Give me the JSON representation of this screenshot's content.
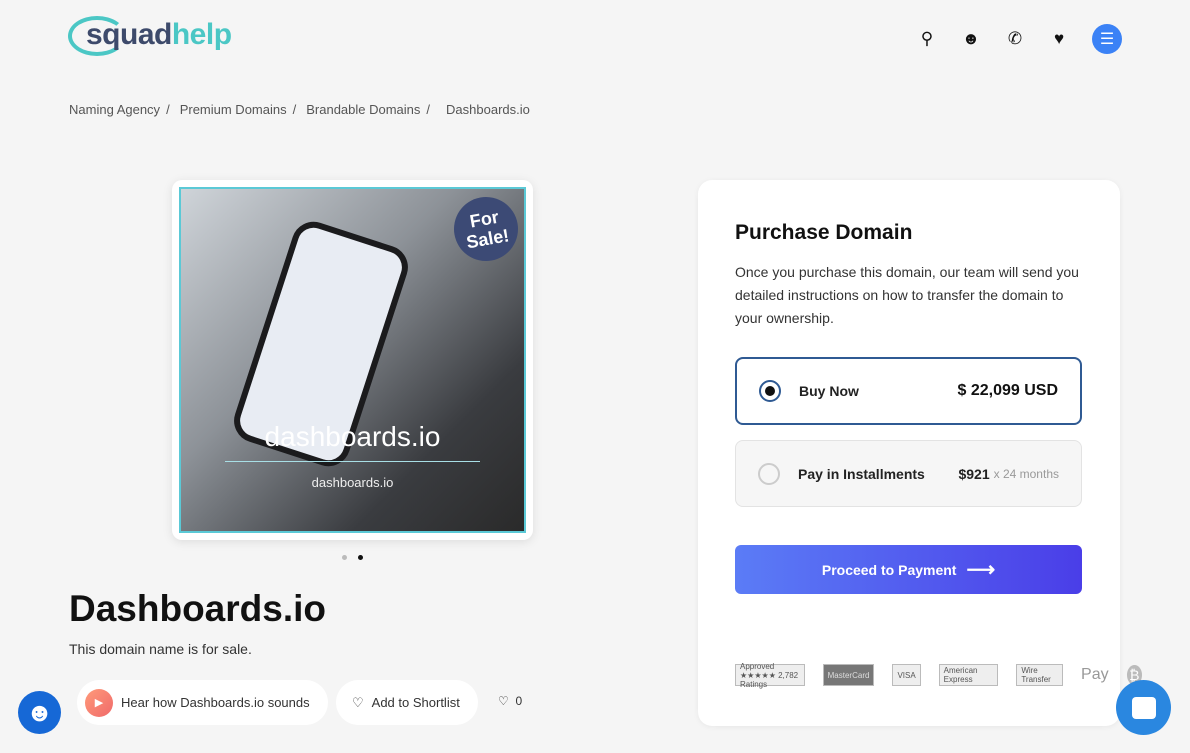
{
  "brand": {
    "part1": "squad",
    "part2": "help",
    "accent": "#4bc7c5"
  },
  "nav": {
    "icons": [
      "search-icon",
      "user-icon",
      "phone-icon",
      "heart-icon",
      "menu-icon"
    ]
  },
  "breadcrumb": [
    "Naming Agency",
    "Premium Domains",
    "Brandable Domains",
    "Dashboards.io"
  ],
  "image": {
    "badge": "For Sale!",
    "domain_large": "dashboards.io",
    "domain_small": "dashboards.io",
    "slides": 2,
    "active_slide": 2
  },
  "domain": {
    "title": "Dashboards.io",
    "subtitle": "This domain name is for sale.",
    "hear_label": "Hear how Dashboards.io sounds",
    "shortlist_label": "Add to Shortlist",
    "likes": "0"
  },
  "purchase": {
    "title": "Purchase Domain",
    "description": "Once you purchase this domain, our team will send you detailed instructions on how to transfer the domain to your ownership.",
    "options": [
      {
        "label": "Buy Now",
        "price": "$ 22,099 USD",
        "selected": true
      },
      {
        "label": "Pay in Installments",
        "price": "$921",
        "suffix": "x 24 months",
        "selected": false
      }
    ],
    "button": "Proceed to Payment",
    "badges": [
      "Approved ★★★★★ 2,782 Ratings",
      "MasterCard",
      "VISA",
      "American Express",
      "Wire Transfer",
      "Pay",
      "₿"
    ]
  }
}
